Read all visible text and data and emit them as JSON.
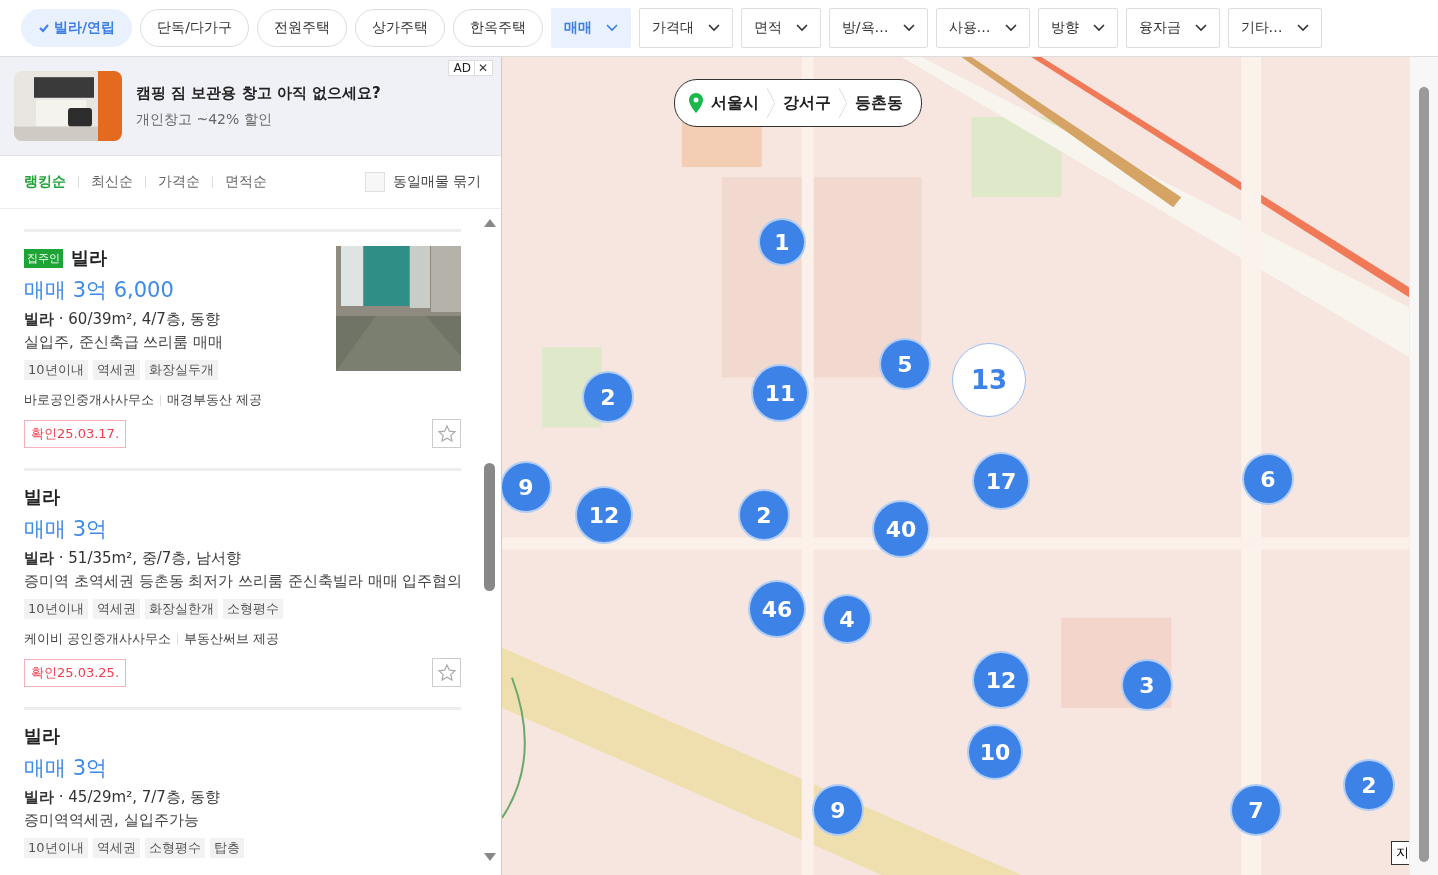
{
  "type_chips": [
    {
      "label": "빌라/연립",
      "selected": true
    },
    {
      "label": "단독/다가구",
      "selected": false
    },
    {
      "label": "전원주택",
      "selected": false
    },
    {
      "label": "상가주택",
      "selected": false
    },
    {
      "label": "한옥주택",
      "selected": false
    }
  ],
  "filters": [
    {
      "label": "매매",
      "selected": true
    },
    {
      "label": "가격대",
      "selected": false
    },
    {
      "label": "면적",
      "selected": false
    },
    {
      "label": "방/욕…",
      "selected": false
    },
    {
      "label": "사용…",
      "selected": false
    },
    {
      "label": "방향",
      "selected": false
    },
    {
      "label": "융자금",
      "selected": false
    },
    {
      "label": "기타…",
      "selected": false
    }
  ],
  "ad": {
    "badge": "AD",
    "close": "✕",
    "title": "캠핑 짐 보관용 창고 아직 없으세요?",
    "subtitle": "개인창고 ~42% 할인"
  },
  "sort_tabs": [
    {
      "label": "랭킹순",
      "selected": true
    },
    {
      "label": "최신순",
      "selected": false
    },
    {
      "label": "가격순",
      "selected": false
    },
    {
      "label": "면적순",
      "selected": false
    }
  ],
  "group_same": {
    "label": "동일매물 묶기",
    "checked": false
  },
  "listings": [
    {
      "owner_badge": "집주인",
      "title": "빌라",
      "price": "매매 3억 6,000",
      "specs": "**빌라** · 60/39m², 4/7층, 동향",
      "description": "실입주, 준신축급 쓰리룸 매매",
      "tags": [
        "10년이내",
        "역세권",
        "화장실두개"
      ],
      "agency": "바로공인중개사사무소",
      "provider": "매경부동산 제공",
      "confirmed": "확인25.03.17.",
      "photo": {
        "kind": "picture"
      },
      "favorite": false
    },
    {
      "title": "빌라",
      "price": "매매 3억",
      "specs": "**빌라** · 51/35m², 중/7층, 남서향",
      "description": "증미역 초역세권 등촌동 최저가 쓰리룸 준신축빌라 매매 입주협의",
      "tags": [
        "10년이내",
        "역세권",
        "화장실한개",
        "소형평수"
      ],
      "agency": "케이비 공인중개사사무소",
      "provider": "부동산써브 제공",
      "confirmed": "확인25.03.25.",
      "favorite": false
    },
    {
      "title": "빌라",
      "price": "매매 3억",
      "specs": "**빌라** · 45/29m², 7/7층, 동향",
      "description": "증미역역세권, 실입주가능",
      "tags": [
        "10년이내",
        "역세권",
        "소형평수",
        "탑층"
      ]
    }
  ],
  "breadcrumb": [
    "서울시",
    "강서구",
    "등촌동"
  ],
  "clusters": [
    {
      "count": "1",
      "selected": false
    },
    {
      "count": "2",
      "selected": false
    },
    {
      "count": "5",
      "selected": false
    },
    {
      "count": "13",
      "selected": true
    },
    {
      "count": "11",
      "selected": false
    },
    {
      "count": "9",
      "selected": false
    },
    {
      "count": "12",
      "selected": false
    },
    {
      "count": "2",
      "selected": false
    },
    {
      "count": "17",
      "selected": false
    },
    {
      "count": "40",
      "selected": false
    },
    {
      "count": "6",
      "selected": false
    },
    {
      "count": "46",
      "selected": false
    },
    {
      "count": "4",
      "selected": false
    },
    {
      "count": "12",
      "selected": false
    },
    {
      "count": "3",
      "selected": false
    },
    {
      "count": "10",
      "selected": false
    },
    {
      "count": "9",
      "selected": false
    },
    {
      "count": "7",
      "selected": false
    },
    {
      "count": "2",
      "selected": false
    }
  ],
  "map_corner_button": "지"
}
